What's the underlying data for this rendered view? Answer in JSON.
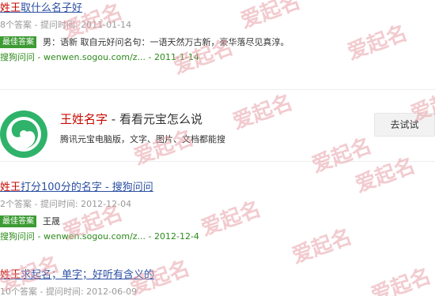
{
  "results": [
    {
      "title_keyword": "姓王",
      "title_rest": "取什么名子好",
      "meta": "8个答案 - 提问时间: 2011-01-14",
      "badge": "最佳答案",
      "answer": "男：语新 取自元好问名句：一语天然万古新，豪华落尽见真淳。",
      "source": "搜狗问问 - wenwen.sogou.com/z... - 2011-1-14"
    },
    {
      "title_keyword": "姓王",
      "title_rest": "打分100分的名字 - 搜狗问问",
      "meta": "2个答案 - 提问时间: 2012-12-04",
      "badge": "最佳答案",
      "answer": "王晟",
      "source": "搜狗问问 - wenwen.sogou.com/z... - 2012-12-4"
    },
    {
      "title_keyword": "姓王",
      "title_rest": "求起名；单字；好听有含义的",
      "meta": "10个答案 - 提问时间: 2012-06-09"
    }
  ],
  "card": {
    "title_keyword": "王姓名字",
    "title_rest": " - 看看元宝怎么说",
    "subtitle": "腾讯元宝电脑版，文字、图片、文档都能搜",
    "button_label": "去试试",
    "logo_icon": "yuanbao-logo-icon"
  },
  "watermark": {
    "text": "爱起名",
    "color": "#e8a0a8"
  }
}
